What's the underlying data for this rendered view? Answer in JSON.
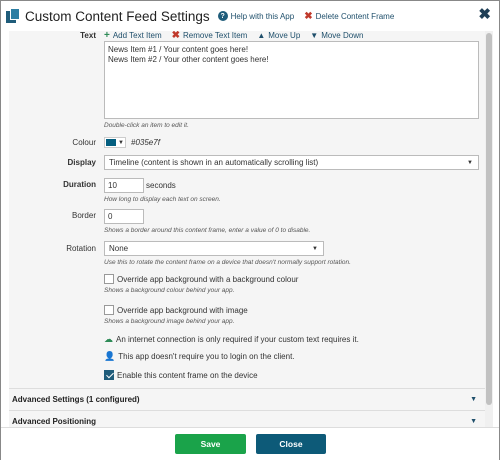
{
  "header": {
    "title": "Custom Content Feed Settings",
    "help_link": "Help with this App",
    "delete_link": "Delete Content Frame",
    "close_glyph": "✖"
  },
  "text_section": {
    "label": "Text",
    "toolbar": {
      "add": "Add Text Item",
      "remove": "Remove Text Item",
      "move_up": "Move Up",
      "move_down": "Move Down"
    },
    "items": [
      "News Item #1 / Your content goes here!",
      "News Item #2 / Your other content goes here!"
    ],
    "hint": "Double-click an item to edit it."
  },
  "colour": {
    "label": "Colour",
    "value": "#035e7f"
  },
  "display": {
    "label": "Display",
    "selected": "Timeline (content is shown in an automatically scrolling list)"
  },
  "duration": {
    "label": "Duration",
    "value": "10",
    "unit": "seconds",
    "hint": "How long to display each text on screen."
  },
  "border": {
    "label": "Border",
    "value": "0",
    "hint": "Shows a border around this content frame, enter a value of 0 to disable."
  },
  "rotation": {
    "label": "Rotation",
    "selected": "None",
    "hint": "Use this to rotate the content frame on a device that doesn't normally support rotation."
  },
  "override_bg_colour": {
    "label": "Override app background with a background colour",
    "checked": false,
    "hint": "Shows a background colour behind your app."
  },
  "override_bg_image": {
    "label": "Override app background with image",
    "checked": false,
    "hint": "Shows a background image behind your app."
  },
  "info": {
    "internet": "An internet connection is only required if your custom text requires it.",
    "login": "This app doesn't require you to login on the client."
  },
  "enable_frame": {
    "label": "Enable this content frame on the device",
    "checked": true
  },
  "sections": {
    "advanced_settings": "Advanced Settings (1 configured)",
    "advanced_positioning": "Advanced Positioning"
  },
  "footer": {
    "save": "Save",
    "close": "Close"
  },
  "colors": {
    "accent": "#1f5c7a",
    "save": "#1aa34a",
    "close": "#0d5a78",
    "swatch": "#035e7f"
  }
}
